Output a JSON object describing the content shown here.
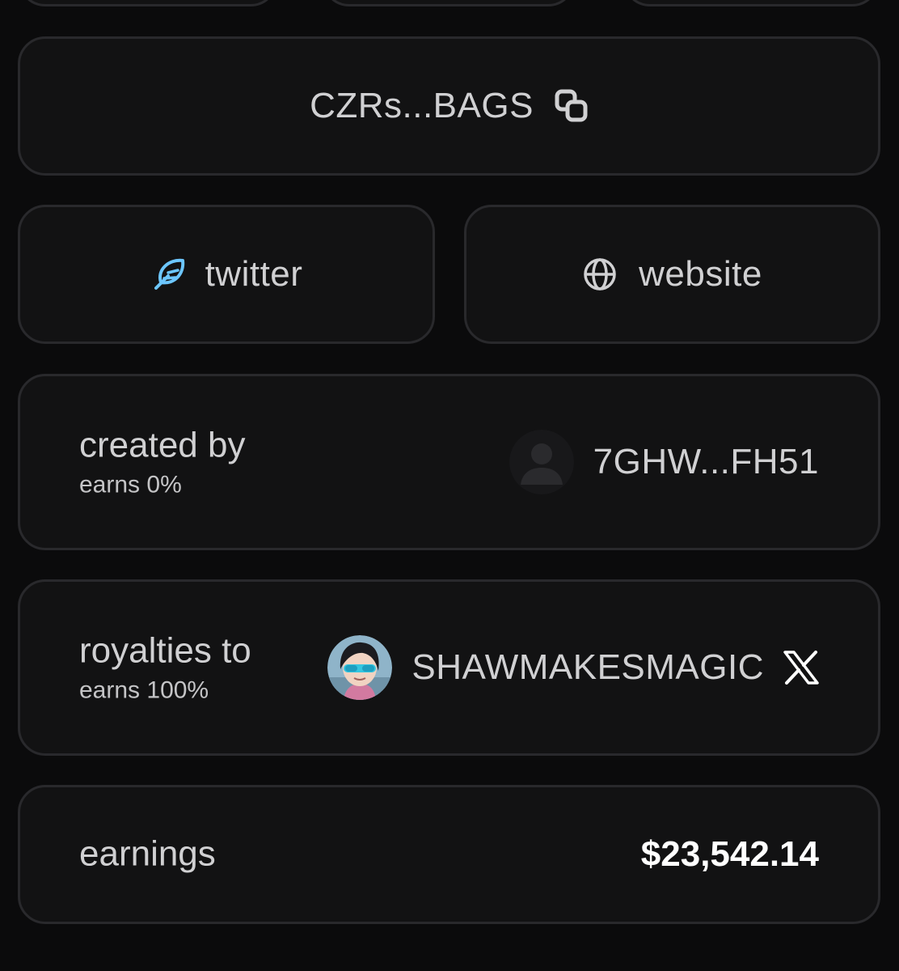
{
  "contract": {
    "address_short": "CZRs...BAGS",
    "copy_icon": "copy-icon"
  },
  "links": {
    "twitter_label": "twitter",
    "twitter_icon": "feather-icon",
    "twitter_icon_color": "#6cc6ff",
    "website_label": "website",
    "website_icon": "globe-icon"
  },
  "creator": {
    "label": "created by",
    "earns": "earns 0%",
    "wallet_short": "7GHW...FH51",
    "avatar_icon": "default-user-avatar"
  },
  "royalties": {
    "label": "royalties to",
    "earns": "earns 100%",
    "handle": "SHAWMAKESMAGIC",
    "social_icon": "x-logo-icon"
  },
  "earnings": {
    "label": "earnings",
    "value": "$23,542.14"
  }
}
